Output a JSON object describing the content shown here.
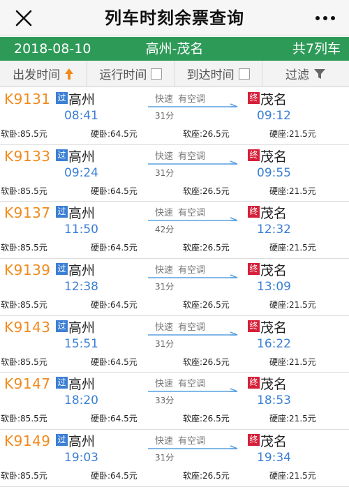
{
  "header": {
    "title": "列车时刻余票查询"
  },
  "info": {
    "date": "2018-08-10",
    "route": "高州-茂名",
    "count": "共7列车"
  },
  "sort": {
    "depart_label": "出发时间",
    "run_label": "运行时间",
    "arrive_label": "到达时间",
    "filter_label": "过滤"
  },
  "tags": {
    "pass": "过",
    "end": "终"
  },
  "colors": {
    "green_bar": "#2e9a58",
    "train_no": "#f08a1c",
    "time": "#3b7fd4",
    "pass_tag": "#3b7fd4",
    "end_tag": "#d6203a",
    "sort_arrow": "#f08a1c"
  },
  "icons": {
    "close": "close-icon",
    "more": "more-dots-icon",
    "sort": "arrow-up-icon",
    "filter": "filter-funnel-icon"
  },
  "trains": [
    {
      "no": "K9131",
      "from": "高州",
      "to": "茂名",
      "dep": "08:41",
      "arr": "09:12",
      "type": "快速",
      "ac": "有空调",
      "duration": "31分",
      "soft_sleeper": "软卧:85.5元",
      "hard_sleeper": "硬卧:64.5元",
      "soft_seat": "软座:26.5元",
      "hard_seat": "硬座:21.5元"
    },
    {
      "no": "K9133",
      "from": "高州",
      "to": "茂名",
      "dep": "09:24",
      "arr": "09:55",
      "type": "快速",
      "ac": "有空调",
      "duration": "31分",
      "soft_sleeper": "软卧:85.5元",
      "hard_sleeper": "硬卧:64.5元",
      "soft_seat": "软座:26.5元",
      "hard_seat": "硬座:21.5元"
    },
    {
      "no": "K9137",
      "from": "高州",
      "to": "茂名",
      "dep": "11:50",
      "arr": "12:32",
      "type": "快速",
      "ac": "有空调",
      "duration": "42分",
      "soft_sleeper": "软卧:85.5元",
      "hard_sleeper": "硬卧:64.5元",
      "soft_seat": "软座:26.5元",
      "hard_seat": "硬座:21.5元"
    },
    {
      "no": "K9139",
      "from": "高州",
      "to": "茂名",
      "dep": "12:38",
      "arr": "13:09",
      "type": "快速",
      "ac": "有空调",
      "duration": "31分",
      "soft_sleeper": "软卧:85.5元",
      "hard_sleeper": "硬卧:64.5元",
      "soft_seat": "软座:26.5元",
      "hard_seat": "硬座:21.5元"
    },
    {
      "no": "K9143",
      "from": "高州",
      "to": "茂名",
      "dep": "15:51",
      "arr": "16:22",
      "type": "快速",
      "ac": "有空调",
      "duration": "31分",
      "soft_sleeper": "软卧:85.5元",
      "hard_sleeper": "硬卧:64.5元",
      "soft_seat": "软座:26.5元",
      "hard_seat": "硬座:21.5元"
    },
    {
      "no": "K9147",
      "from": "高州",
      "to": "茂名",
      "dep": "18:20",
      "arr": "18:53",
      "type": "快速",
      "ac": "有空调",
      "duration": "33分",
      "soft_sleeper": "软卧:85.5元",
      "hard_sleeper": "硬卧:64.5元",
      "soft_seat": "软座:26.5元",
      "hard_seat": "硬座:21.5元"
    },
    {
      "no": "K9149",
      "from": "高州",
      "to": "茂名",
      "dep": "19:03",
      "arr": "19:34",
      "type": "快速",
      "ac": "有空调",
      "duration": "31分",
      "soft_sleeper": "软卧:85.5元",
      "hard_sleeper": "硬卧:64.5元",
      "soft_seat": "软座:26.5元",
      "hard_seat": "硬座:21.5元"
    }
  ]
}
